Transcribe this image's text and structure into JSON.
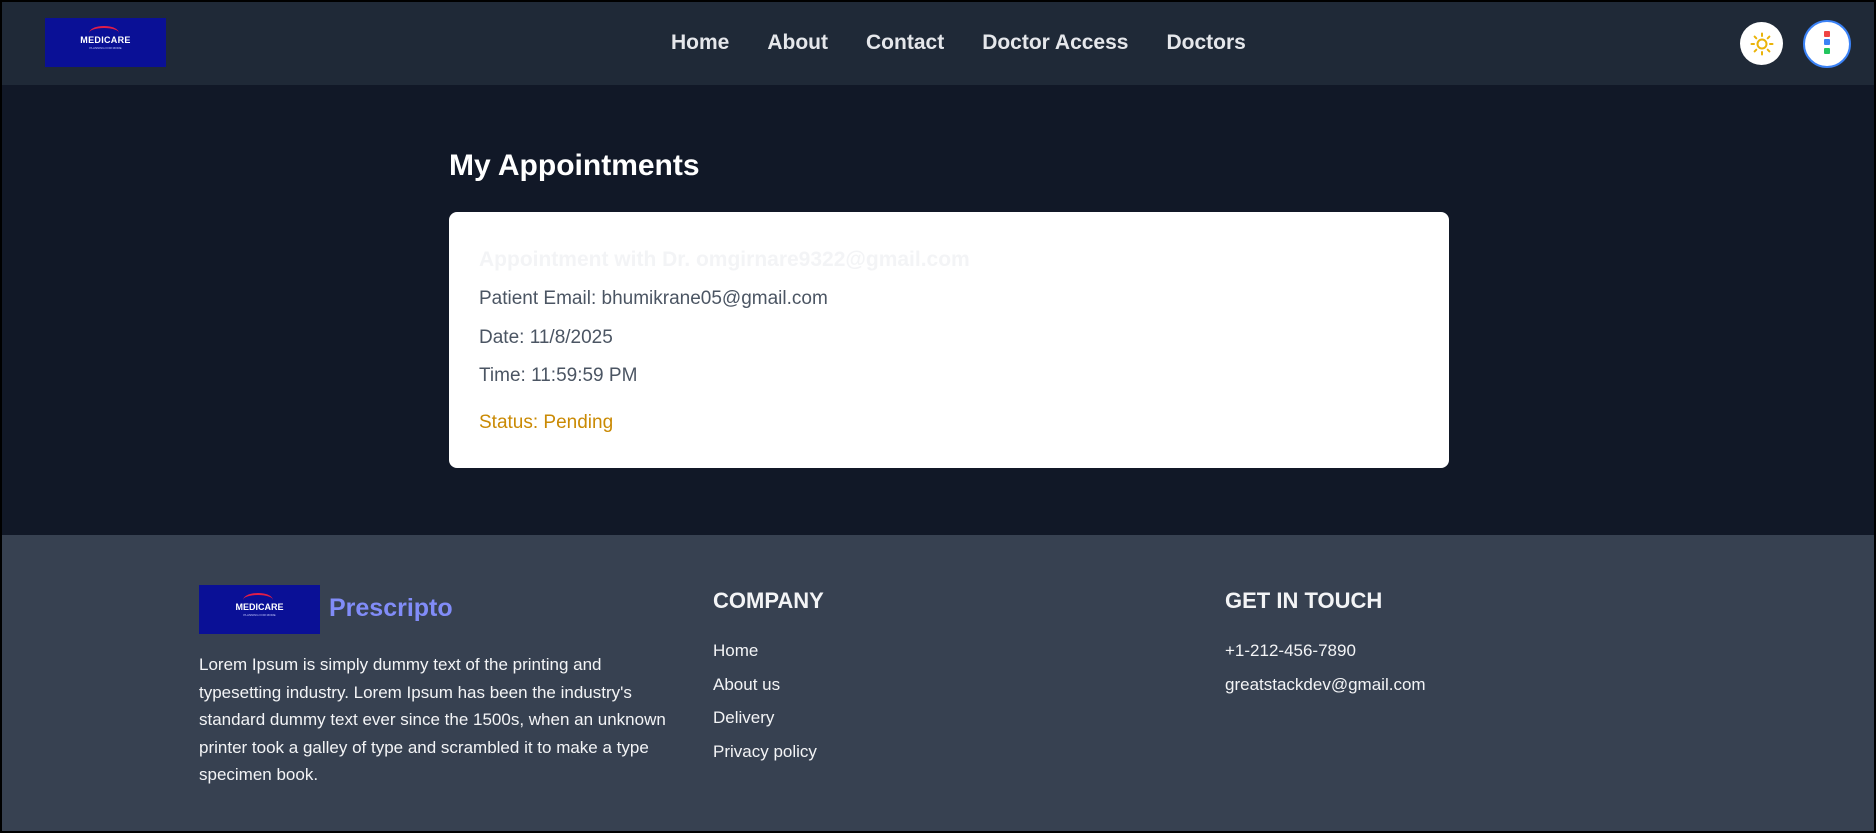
{
  "header": {
    "logo": {
      "title": "MEDICARE",
      "subtitle": "PLANNING FOR MORE",
      "icon": "medicare-logo"
    },
    "nav": [
      {
        "label": "Home"
      },
      {
        "label": "About"
      },
      {
        "label": "Contact"
      },
      {
        "label": "Doctor Access"
      },
      {
        "label": "Doctors"
      }
    ],
    "theme_toggle_icon": "sun-icon",
    "avatar_icon": "profile-avatar",
    "colors": {
      "nav_bg": "#1f2937",
      "page_bg": "#111827"
    }
  },
  "main": {
    "title": "My Appointments",
    "appointment": {
      "heading": "Appointment with Dr. omgirnare9322@gmail.com",
      "patient_email": "Patient Email: bhumikrane05@gmail.com",
      "date": "Date: 11/8/2025",
      "time": "Time: 11:59:59 PM",
      "status": "Status: Pending",
      "status_color": "#ca8a04"
    }
  },
  "footer": {
    "logo": {
      "title": "MEDICARE",
      "subtitle": "PLANNING FOR MORE"
    },
    "brand": "Prescripto",
    "description": "Lorem Ipsum is simply dummy text of the printing and typesetting industry. Lorem Ipsum has been the industry's standard dummy text ever since the 1500s, when an unknown printer took a galley of type and scrambled it to make a type specimen book.",
    "company": {
      "heading": "COMPANY",
      "links": [
        {
          "label": "Home"
        },
        {
          "label": "About us"
        },
        {
          "label": "Delivery"
        },
        {
          "label": "Privacy policy"
        }
      ]
    },
    "contact": {
      "heading": "GET IN TOUCH",
      "phone": "+1-212-456-7890",
      "email": "greatstackdev@gmail.com"
    },
    "colors": {
      "footer_bg": "#374151",
      "brand": "#818cf8"
    }
  }
}
